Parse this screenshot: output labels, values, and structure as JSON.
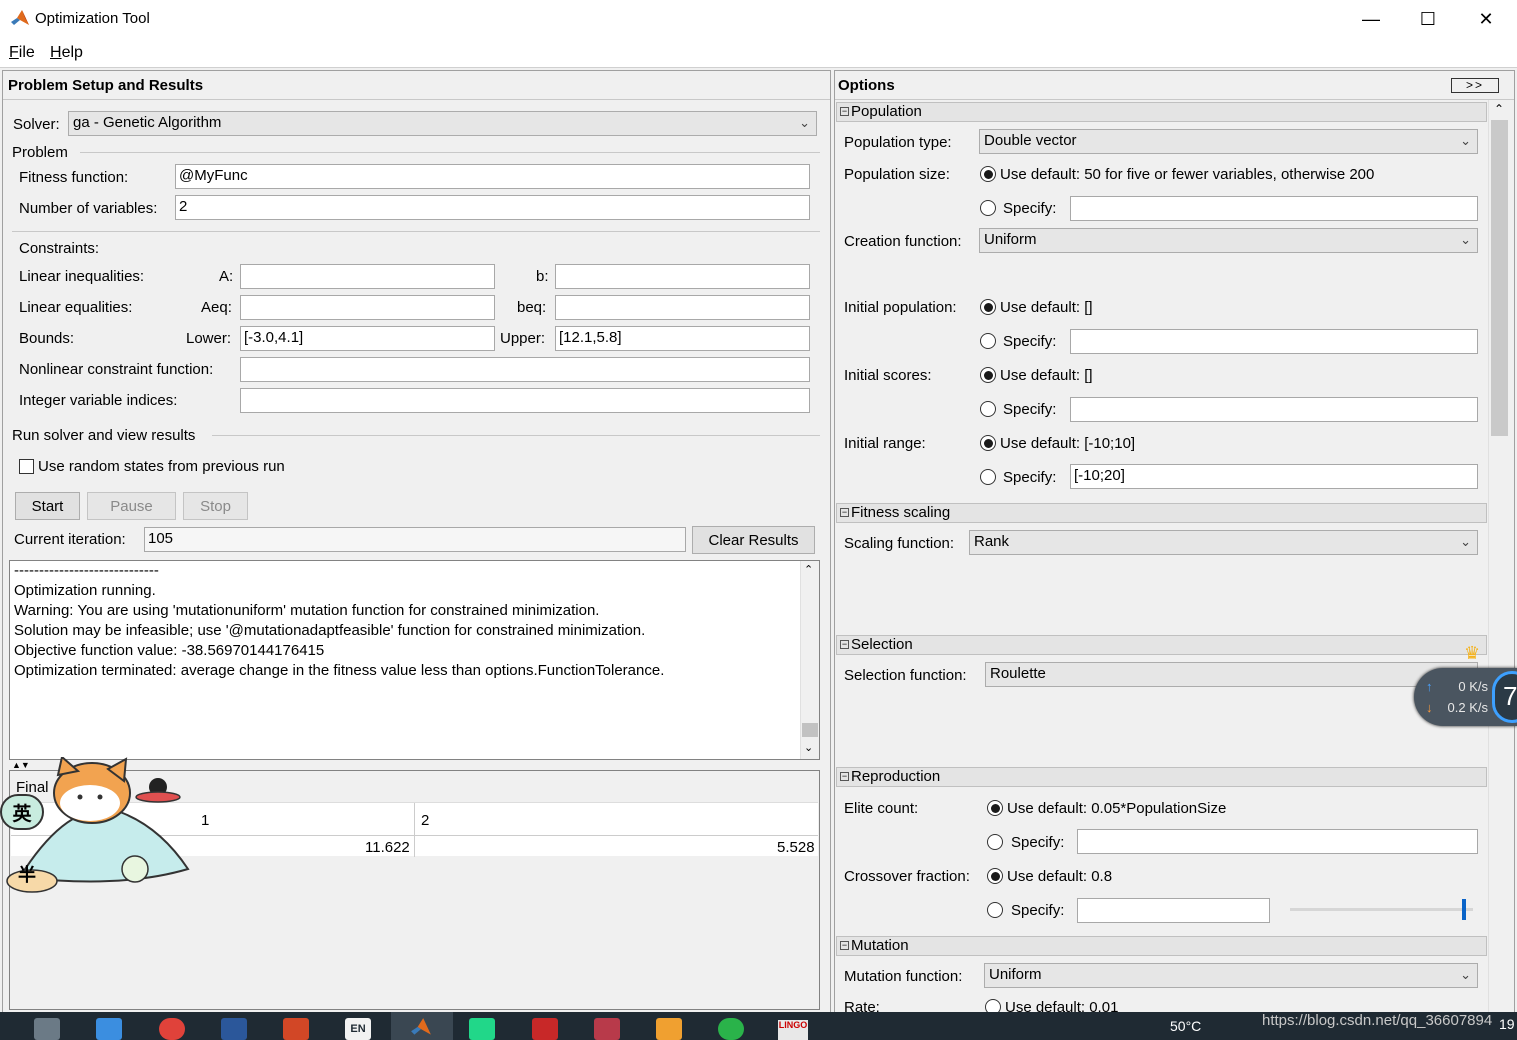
{
  "window": {
    "title": "Optimization Tool",
    "minimize": "—",
    "maximize": "☐",
    "close": "✕"
  },
  "menu": {
    "file": "File",
    "help": "Help"
  },
  "left": {
    "header": "Problem Setup and Results",
    "solver_label": "Solver:",
    "solver_value": "ga - Genetic Algorithm",
    "problem_group": "Problem",
    "fitness_label": "Fitness function:",
    "fitness_value": "@MyFunc",
    "nvars_label": "Number of variables:",
    "nvars_value": "2",
    "constraints_label": "Constraints:",
    "lin_ineq_label": "Linear inequalities:",
    "a_label": "A:",
    "a_value": "",
    "b_label": "b:",
    "b_value": "",
    "lin_eq_label": "Linear equalities:",
    "aeq_label": "Aeq:",
    "aeq_value": "",
    "beq_label": "beq:",
    "beq_value": "",
    "bounds_label": "Bounds:",
    "lower_label": "Lower:",
    "lower_value": "[-3.0,4.1]",
    "upper_label": "Upper:",
    "upper_value": "[12.1,5.8]",
    "nonlcon_label": "Nonlinear constraint function:",
    "nonlcon_value": "",
    "intcon_label": "Integer variable indices:",
    "intcon_value": "",
    "run_group": "Run solver and view results",
    "random_states_label": "Use random states from previous run",
    "start_label": "Start",
    "pause_label": "Pause",
    "stop_label": "Stop",
    "iteration_label": "Current iteration:",
    "iteration_value": "105",
    "clear_label": "Clear Results",
    "log_lines": [
      "-----------------------------",
      "Optimization running.",
      "Warning: You are using 'mutationuniform' mutation function for constrained minimization.",
      "Solution may be infeasible; use '@mutationadaptfeasible' function for constrained minimization.",
      "Objective function value: -38.56970144176415",
      "Optimization terminated: average change in the fitness value less than options.FunctionTolerance."
    ],
    "final_label": "Final",
    "final_table": {
      "headers": [
        "1",
        "2"
      ],
      "values": [
        "11.622",
        "5.528"
      ]
    }
  },
  "right": {
    "header": "Options",
    "expand_label": ">>",
    "population": {
      "title": "Population",
      "type_label": "Population type:",
      "type_value": "Double vector",
      "size_label": "Population size:",
      "size_default": "Use default: 50 for five or fewer variables, otherwise 200",
      "size_specify": "Specify:",
      "size_specify_value": "",
      "creation_label": "Creation function:",
      "creation_value": "Uniform",
      "initpop_label": "Initial population:",
      "initpop_default": "Use default: []",
      "initpop_specify": "Specify:",
      "initpop_specify_value": "",
      "initscores_label": "Initial scores:",
      "initscores_default": "Use default: []",
      "initscores_specify": "Specify:",
      "initscores_specify_value": "",
      "initrange_label": "Initial range:",
      "initrange_default": "Use default: [-10;10]",
      "initrange_specify": "Specify:",
      "initrange_specify_value": "[-10;20]"
    },
    "fitness_scaling": {
      "title": "Fitness scaling",
      "scaling_label": "Scaling function:",
      "scaling_value": "Rank"
    },
    "selection": {
      "title": "Selection",
      "selection_label": "Selection function:",
      "selection_value": "Roulette"
    },
    "reproduction": {
      "title": "Reproduction",
      "elite_label": "Elite count:",
      "elite_default": "Use default: 0.05*PopulationSize",
      "elite_specify": "Specify:",
      "elite_specify_value": "",
      "crossover_label": "Crossover fraction:",
      "crossover_default": "Use default: 0.8",
      "crossover_specify": "Specify:",
      "crossover_specify_value": "",
      "crossover_slider": 0.95
    },
    "mutation": {
      "title": "Mutation",
      "mutation_label": "Mutation function:",
      "mutation_value": "Uniform",
      "rate_label": "Rate:",
      "rate_default": "Use default: 0.01"
    }
  },
  "overlays": {
    "ime_char_1": "英",
    "ime_char_2": "半",
    "net_up": "0 K/s",
    "net_down": "0.2 K/s",
    "net_badge": "7"
  },
  "taskbar": {
    "temperature": "50°C",
    "watermark": "https://blog.csdn.net/qq_36607894",
    "clock_fragment": "19",
    "lingo_label": "LINGO",
    "en_label": "EN"
  },
  "colors": {
    "accent": "#0a64c8",
    "taskbar": "#1f2a33"
  }
}
